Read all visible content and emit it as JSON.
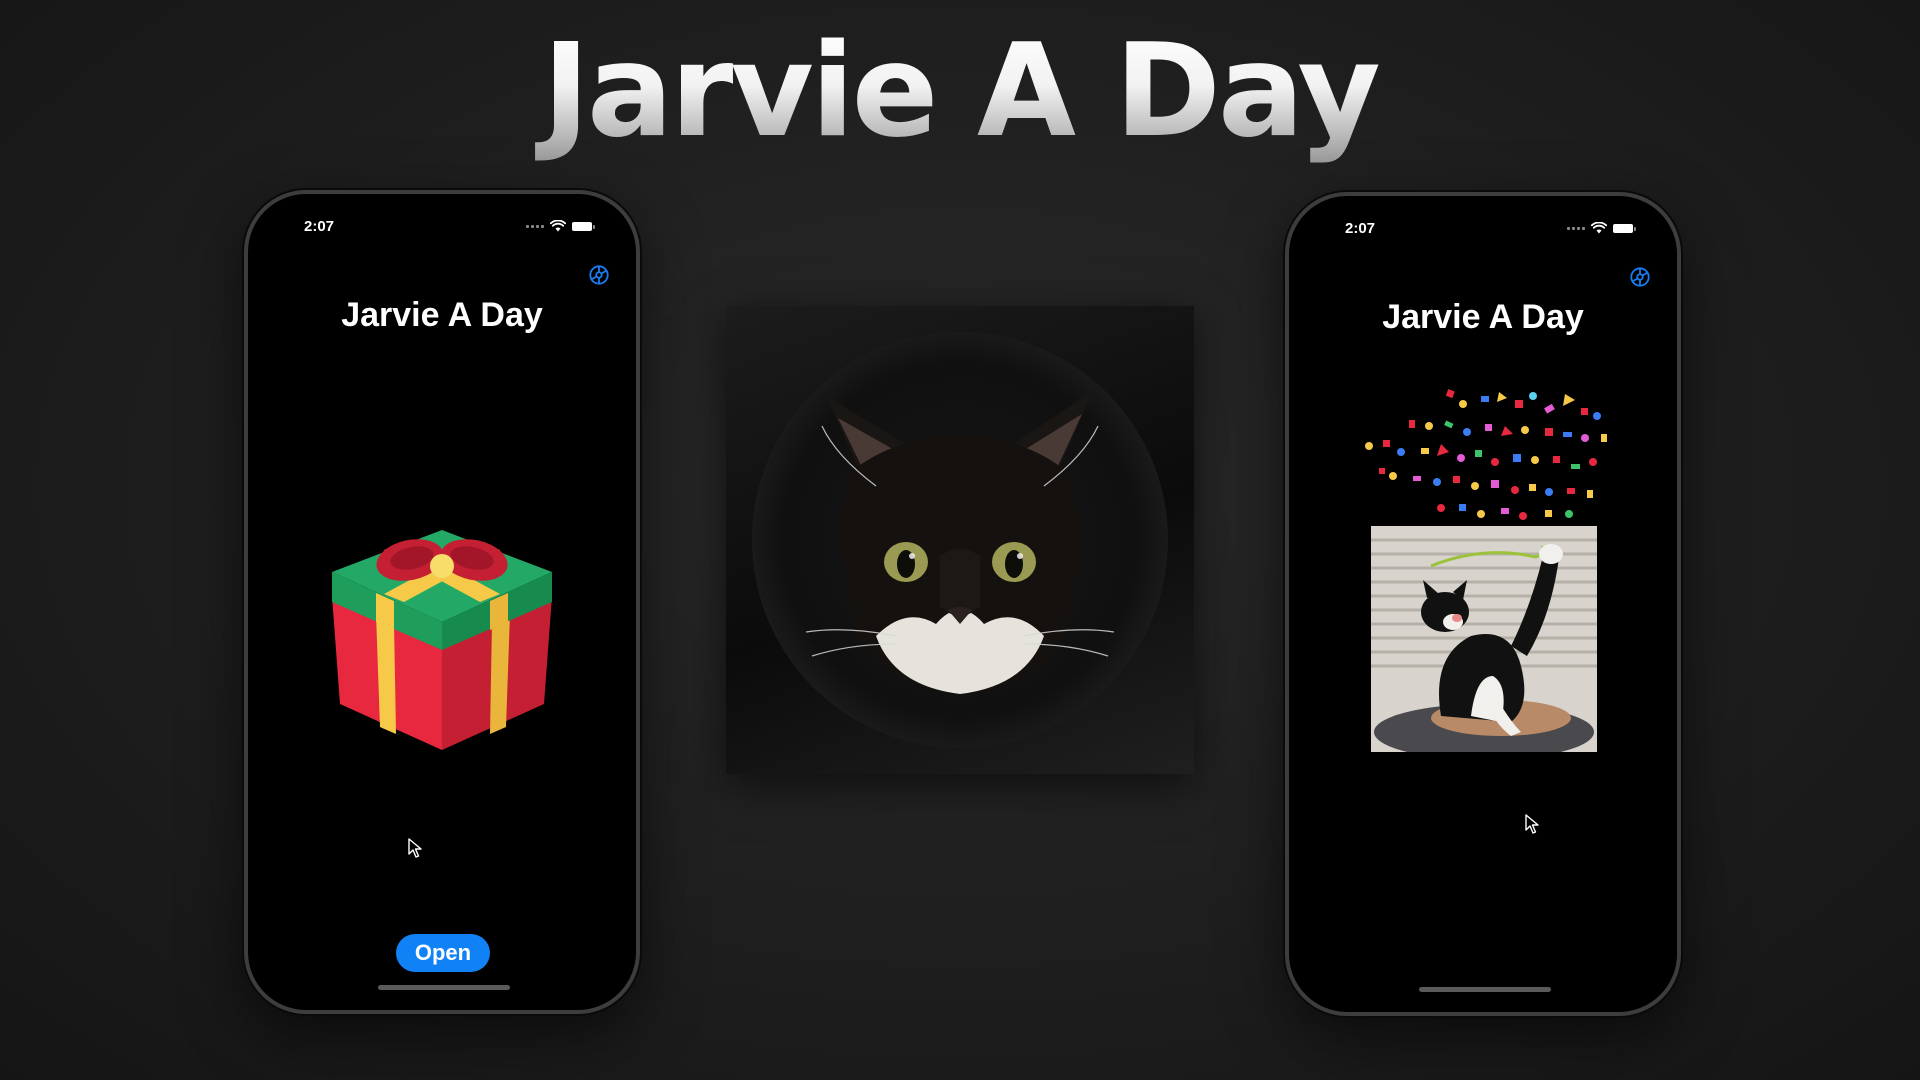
{
  "header": {
    "title": "Jarvie A Day"
  },
  "phone_left": {
    "status_time": "2:07",
    "app_title": "Jarvie A Day",
    "open_button_label": "Open",
    "icons": [
      "signal-icon",
      "wifi-icon",
      "battery-icon",
      "settings-icon",
      "gift-icon",
      "cursor-icon"
    ]
  },
  "center_image": {
    "icon": "cat-face-icon"
  },
  "phone_right": {
    "status_time": "2:07",
    "app_title": "Jarvie A Day",
    "icons": [
      "signal-icon",
      "wifi-icon",
      "battery-icon",
      "settings-icon",
      "confetti-icon",
      "cat-photo-icon",
      "cursor-icon"
    ]
  },
  "colors": {
    "accent_blue": "#1182f5",
    "gift_red": "#e8283f",
    "gift_green": "#1f9e5b",
    "gift_ribbon": "#f7c948"
  }
}
